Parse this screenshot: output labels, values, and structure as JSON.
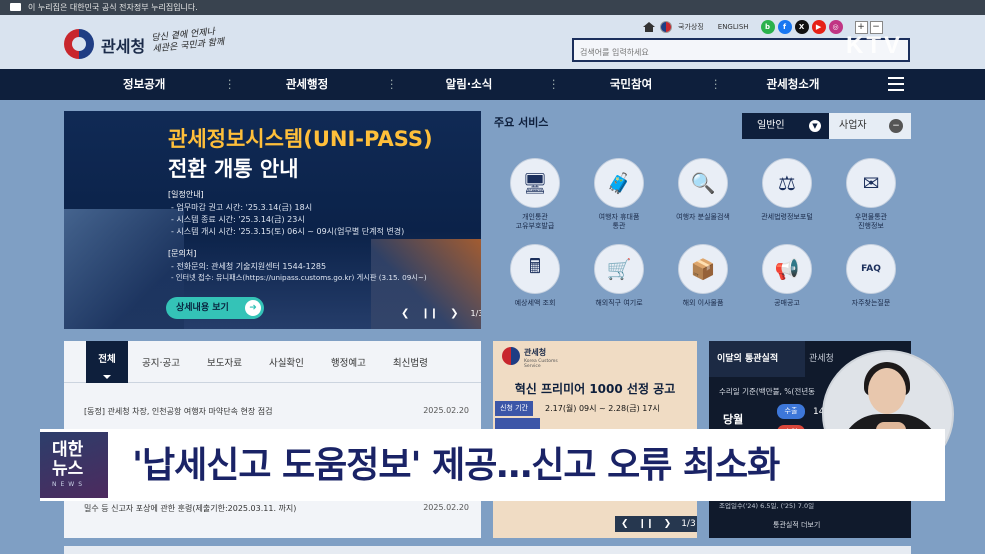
{
  "gov_strip": {
    "text": "이 누리집은 대한민국 공식 전자정부 누리집입니다."
  },
  "header": {
    "logo_text": "관세청",
    "slogan_line1": "당신 곁에 언제나",
    "slogan_line2": "세관은 국민과 함께",
    "top_links": [
      "국가상징",
      "ENGLISH"
    ],
    "sns": [
      "b",
      "f",
      "X",
      "▶",
      "◎"
    ],
    "zoom": [
      "+",
      "−"
    ],
    "search_placeholder": "검색어를 입력하세요"
  },
  "broadcast": {
    "logo": "KTV"
  },
  "nav": {
    "items": [
      "정보공개",
      "관세행정",
      "알림·소식",
      "국민참여",
      "관세청소개"
    ]
  },
  "banner": {
    "title": "관세정보시스템(UNI-PASS)",
    "subtitle": "전환 개통 안내",
    "schedule_heading": "[일정안내]",
    "schedule": [
      "- 업무마감 권고 시간: '25.3.14(금) 18시",
      "- 시스템 종료 시간: '25.3.14(금) 23시",
      "- 시스템 개시 시간: '25.3.15(토) 06시 ~ 09시(업무별 단계적 변경)"
    ],
    "inquiry_heading": "[문의처]",
    "inquiry": [
      "- 전화문의: 관세청 기술지원센터 1544-1285",
      "- 인터넷 접수: 유니패스(https://unipass.customs.go.kr) 게시판 (3.15. 09시~)"
    ],
    "button_label": "상세내용 보기",
    "page": "1/3"
  },
  "services": {
    "title": "주요 서비스",
    "tab_general": "일반인",
    "tab_business": "사업자",
    "items": [
      {
        "label": "개인통관\n고유부호발급",
        "icon": "id-card-icon",
        "glyph": "🖥"
      },
      {
        "label": "여행자 휴대품\n통관",
        "icon": "luggage-icon",
        "glyph": "🧳"
      },
      {
        "label": "여행자 분실물검색",
        "icon": "magnifier-icon",
        "glyph": "🔍"
      },
      {
        "label": "관세법령정보포털",
        "icon": "gavel-icon",
        "glyph": "⚖"
      },
      {
        "label": "우편물통관\n진행정보",
        "icon": "mail-icon",
        "glyph": "✉"
      },
      {
        "label": "예상세액 조회",
        "icon": "calculator-icon",
        "glyph": "🖩"
      },
      {
        "label": "해외직구 여기로",
        "icon": "cart-icon",
        "glyph": "🛒"
      },
      {
        "label": "해외 이사물품",
        "icon": "box-icon",
        "glyph": "📦"
      },
      {
        "label": "공매공고",
        "icon": "megaphone-icon",
        "glyph": "📢"
      },
      {
        "label": "자주찾는질문",
        "icon": "faq-icon",
        "glyph": "FAQ"
      }
    ]
  },
  "board": {
    "tabs": [
      "전체",
      "공지·공고",
      "보도자료",
      "사실확인",
      "행정예고",
      "최신법령"
    ],
    "rows": [
      {
        "title": "[동정] 관세청 차장, 인천공항 여행자 마약단속 현장 점검",
        "date": "2025.02.20"
      },
      {
        "title": "밀수 등 신고자 포상에 관한 훈령(제출기한:2025.03.11. 까지)",
        "date": "2025.02.20"
      }
    ]
  },
  "promo": {
    "org": "관세청",
    "org_en": "Korea Customs Service",
    "title": "혁신 프리미어 1000 선정 공고",
    "period_label": "신청 기간",
    "period": "2.17(월) 09시 ~ 2.28(금) 17시",
    "page": "1/3"
  },
  "stats": {
    "tab_active": "이달의 통관실적",
    "tab_other": "관세청",
    "note": "수리일 기준(백만불, %(전년동",
    "row_label": "당월",
    "pill_import": "수출",
    "value": "14,",
    "pill2": "수입",
    "bottom_note": "조업일수('24) 6.5일, ('25) 7.0일",
    "more": "통관실적 더보기"
  },
  "caption": {
    "box_line1": "대한",
    "box_line2": "뉴스",
    "box_sub": "NEWS",
    "headline": "'납세신고 도움정보' 제공…신고 오류 최소화"
  }
}
